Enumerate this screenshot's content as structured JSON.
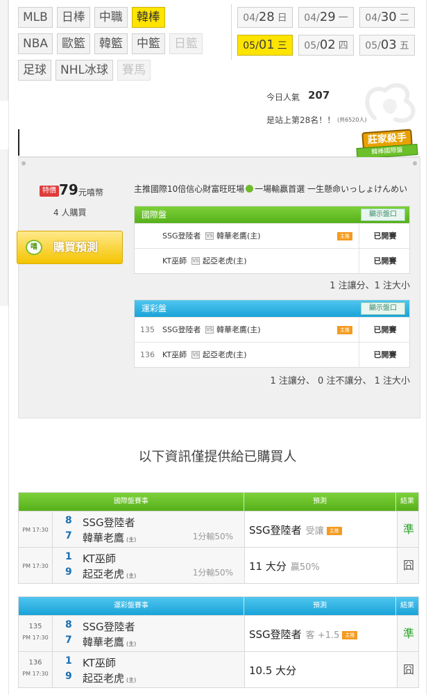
{
  "leagues": {
    "row1": [
      {
        "label": "MLB",
        "state": "normal"
      },
      {
        "label": "日棒",
        "state": "normal"
      },
      {
        "label": "中職",
        "state": "normal"
      },
      {
        "label": "韓棒",
        "state": "active"
      }
    ],
    "row2": [
      {
        "label": "NBA",
        "state": "normal"
      },
      {
        "label": "歐籃",
        "state": "normal"
      },
      {
        "label": "韓籃",
        "state": "normal"
      },
      {
        "label": "中籃",
        "state": "normal"
      },
      {
        "label": "日籃",
        "state": "disabled"
      }
    ],
    "row3": [
      {
        "label": "足球",
        "state": "normal"
      },
      {
        "label": "NHL冰球",
        "state": "normal"
      },
      {
        "label": "賽馬",
        "state": "disabled"
      }
    ]
  },
  "dates": {
    "row1": [
      {
        "md": "04/",
        "d": "28",
        "wd": "日",
        "active": false
      },
      {
        "md": "04/",
        "d": "29",
        "wd": "一",
        "active": false
      },
      {
        "md": "04/",
        "d": "30",
        "wd": "二",
        "active": false
      }
    ],
    "row2": [
      {
        "md": "05/",
        "d": "01",
        "wd": "三",
        "active": true
      },
      {
        "md": "05/",
        "d": "02",
        "wd": "四",
        "active": false
      },
      {
        "md": "05/",
        "d": "03",
        "wd": "五",
        "active": false
      }
    ]
  },
  "popularity": {
    "label": "今日人氣",
    "value": "207",
    "rank_text": "是站上第28名！！",
    "rank_total": "(共6520人)"
  },
  "badge": {
    "title": "莊家殺手",
    "subtitle": "韓棒國際盤"
  },
  "purchase": {
    "tag": "特價",
    "price": "79",
    "unit": "元嘻幣",
    "buyers": "4 人購買",
    "button_label": "購買預測",
    "icon_text": "嘻"
  },
  "headline": {
    "before": "主推國際10倍信心財富旺旺場",
    "after": "一場輸贏首選 一生懸命いっしょけんめい"
  },
  "intl_panel": {
    "title": "國際盤",
    "show_button": "顯示盤口",
    "rows": [
      {
        "num": "",
        "away": "SSG登陸者",
        "home": "韓華老鷹(主)",
        "tag": "主推",
        "status": "已開賽"
      },
      {
        "num": "",
        "away": "KT巫師",
        "home": "起亞老虎(主)",
        "tag": "",
        "status": "已開賽"
      }
    ],
    "summary": "1 注讓分、1 注大小"
  },
  "lottery_panel": {
    "title": "運彩盤",
    "show_button": "顯示盤口",
    "rows": [
      {
        "num": "135",
        "away": "SSG登陸者",
        "home": "韓華老鷹(主)",
        "tag": "主推",
        "status": "已開賽"
      },
      {
        "num": "136",
        "away": "KT巫師",
        "home": "起亞老虎(主)",
        "tag": "",
        "status": "已開賽"
      }
    ],
    "summary": "1 注讓分、 0 注不讓分、 1 注大小"
  },
  "notice": "以下資訊僅提供給已購買人",
  "intl_results": {
    "headers": [
      "國際盤賽事",
      "預測",
      "結果"
    ],
    "rows": [
      {
        "num": "",
        "time": "PM 17:30",
        "score1": "8",
        "team1": "SSG登陸者",
        "score2": "7",
        "team2": "韓華老鷹",
        "home_mark": "(主)",
        "odds": "1分輸50%",
        "pred": "SSG登陸者",
        "pred_sub": "受讓",
        "pred_tag": "主推",
        "result": "準",
        "hit": true
      },
      {
        "num": "",
        "time": "PM 17:30",
        "score1": "1",
        "team1": "KT巫師",
        "score2": "9",
        "team2": "起亞老虎",
        "home_mark": "(主)",
        "odds": "1分輸50%",
        "pred": "11 大分",
        "pred_sub": "贏50%",
        "pred_tag": "",
        "result": "囧",
        "hit": false
      }
    ]
  },
  "lottery_results": {
    "headers": [
      "運彩盤賽事",
      "預測",
      "結果"
    ],
    "rows": [
      {
        "num": "135",
        "time": "PM 17:30",
        "score1": "8",
        "team1": "SSG登陸者",
        "score2": "7",
        "team2": "韓華老鷹",
        "home_mark": "(主)",
        "odds": "",
        "pred": "SSG登陸者",
        "pred_sub": "客 +1.5",
        "pred_tag": "主推",
        "result": "準",
        "hit": true
      },
      {
        "num": "136",
        "time": "PM 17:30",
        "score1": "1",
        "team1": "KT巫師",
        "score2": "9",
        "team2": "起亞老虎",
        "home_mark": "(主)",
        "odds": "",
        "pred": "10.5 大分",
        "pred_sub": "",
        "pred_tag": "",
        "result": "囧",
        "hit": false
      }
    ]
  }
}
